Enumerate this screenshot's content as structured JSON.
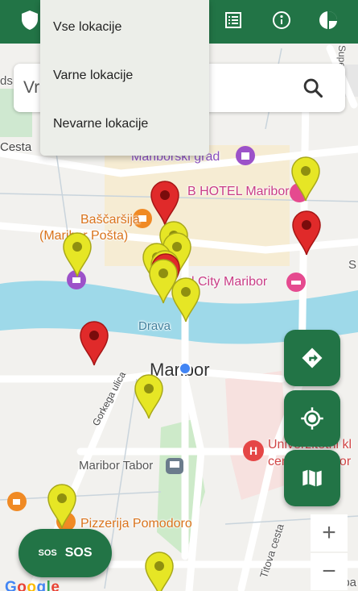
{
  "top_bar": {
    "icons": [
      "shield-icon",
      "list-icon",
      "info-icon",
      "pie-chart-icon"
    ],
    "color": "#227446"
  },
  "location_menu": {
    "items": [
      "Vse lokacije",
      "Varne lokacije",
      "Nevarne lokacije"
    ]
  },
  "search": {
    "partial_text": "Vr",
    "icon": "search-icon"
  },
  "map": {
    "place_labels": {
      "marborski_grad": "Mariborski grad",
      "hotel_b": "B HOTEL Maribor",
      "bascarsija": "Baščaršija",
      "bascarsija_sub": "(Maribor Pošta)",
      "city_hotel": "l City Maribor",
      "drava": "Drava",
      "maribor": "Maribor",
      "gorkega": "Gorkega ulica",
      "tabor": "Maribor Tabor",
      "univerza_1": "Univerzitetni kl",
      "univerza_2": "center Maribor",
      "pizzerija": "Pizzerija Pomodoro",
      "titova": "Titova cesta",
      "cesta": "Cesta",
      "ds": "ds",
      "supe": "Supe",
      "edge_s": "S",
      "google": "Google",
      "apa": "apa"
    },
    "pin_colors": {
      "safe": "#e6e625",
      "unsafe": "#e02a2a"
    }
  },
  "buttons": {
    "directions": "directions-icon",
    "my_location": "my-location-icon",
    "map_layers": "map-icon",
    "zoom_in": "+",
    "zoom_out": "−",
    "sos_small": "SOS",
    "sos_label": "SOS"
  }
}
